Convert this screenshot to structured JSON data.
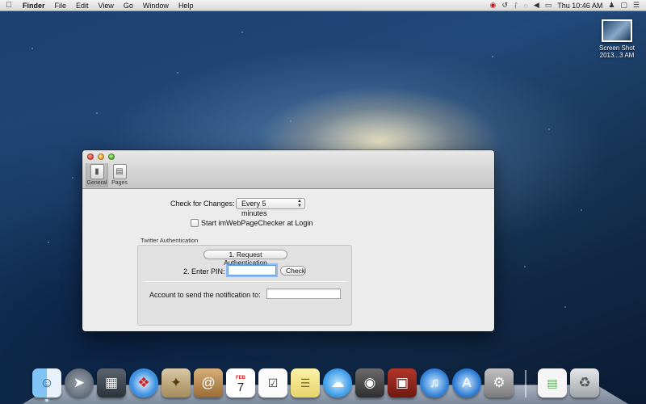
{
  "menubar": {
    "apple_icon": "apple-icon",
    "app_name": "Finder",
    "items": [
      "File",
      "Edit",
      "View",
      "Go",
      "Window",
      "Help"
    ],
    "clock": "Thu 10:46 AM",
    "status_icons": [
      "eye-icon",
      "time-machine-icon",
      "bluetooth-icon",
      "wifi-icon",
      "volume-icon",
      "battery-icon",
      "user-icon",
      "airplay-icon",
      "list-icon"
    ]
  },
  "desktop": {
    "file": {
      "name_line1": "Screen Shot",
      "name_line2": "2013...3 AM"
    }
  },
  "window": {
    "tabs": [
      {
        "label": "General",
        "icon": "info-switch-icon"
      },
      {
        "label": "Pages",
        "icon": "page-icon"
      }
    ],
    "check_for_changes_label": "Check for Changes:",
    "check_interval_value": "Every 5 minutes",
    "start_at_login_label": "Start imWebPageChecker at Login",
    "twitter_group_title": "Twitter Authentication",
    "request_auth_button": "1. Request Authentication",
    "enter_pin_label": "2. Enter PIN:",
    "pin_value": "",
    "check_button": "Check",
    "account_label": "Account to send the notification to:",
    "account_value": ""
  },
  "dock": {
    "items": [
      "finder-icon",
      "launchpad-icon",
      "mission-control-icon",
      "safari-icon",
      "mail-icon",
      "contacts-icon",
      "calendar-icon",
      "reminders-icon",
      "notes-icon",
      "messages-icon",
      "facetime-icon",
      "photo-booth-icon",
      "itunes-icon",
      "app-store-icon",
      "system-preferences-icon",
      "document-icon",
      "trash-icon"
    ],
    "calendar_month": "FEB",
    "calendar_day": "7"
  }
}
